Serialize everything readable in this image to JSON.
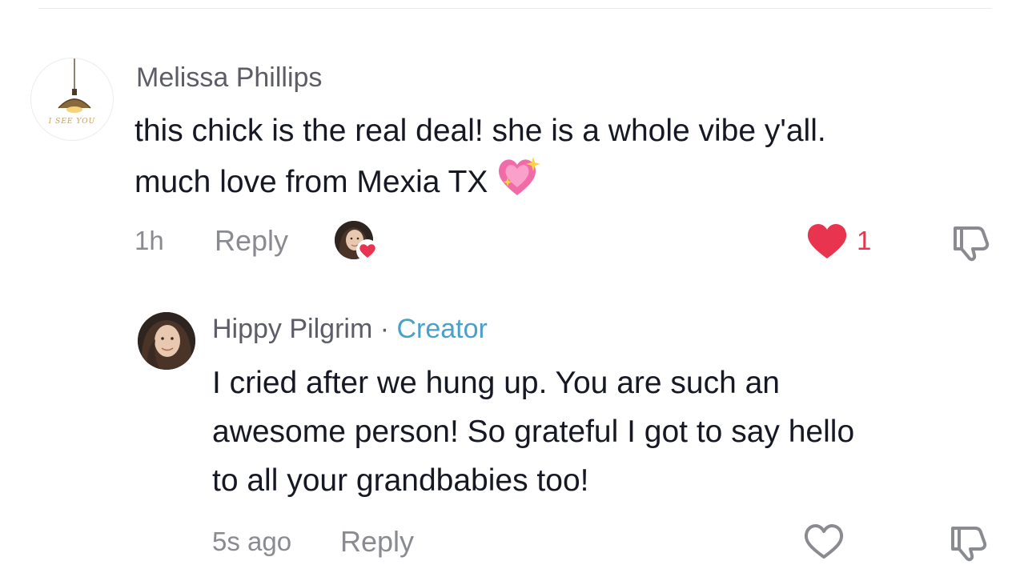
{
  "comment": {
    "username": "Melissa Phillips",
    "avatar_text": "I SEE YOU",
    "text": "this chick is the real deal! she is a whole vibe y'all. much love from Mexia TX",
    "line1": "this chick is the real deal! she is a whole vibe y'all.",
    "line2": "much love from Mexia TX",
    "emoji": "sparkling-heart-icon",
    "time": "1h",
    "reply_label": "Reply",
    "creator_liked": true,
    "likes": "1",
    "liked": true,
    "like_color": "#e8344e"
  },
  "reply": {
    "username": "Hippy Pilgrim",
    "separator": " · ",
    "badge": "Creator",
    "badge_color": "#4aa0c9",
    "line1": "I cried after we hung up. You are such an",
    "line2": "awesome person! So grateful I got to say hello",
    "line3": "to all your grandbabies too!",
    "time": "5s ago",
    "reply_label": "Reply",
    "liked": false
  }
}
